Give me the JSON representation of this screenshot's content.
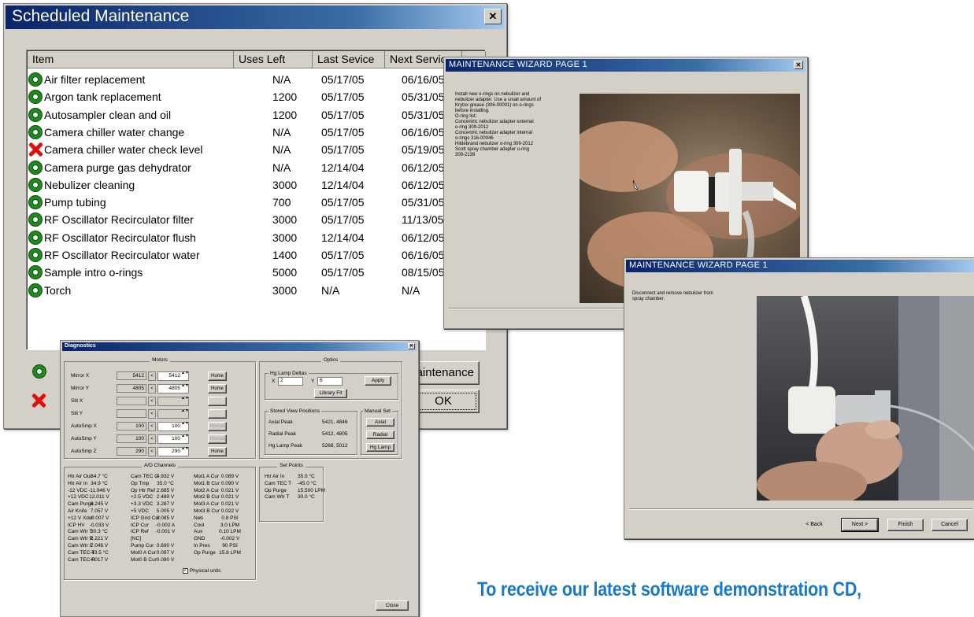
{
  "maint": {
    "title": "Scheduled Maintenance",
    "close": "✕",
    "headers": [
      "Item",
      "Uses Left",
      "Last Sevice",
      "Next Service"
    ],
    "rows": [
      {
        "status": "ok",
        "item": "Air filter replacement",
        "uses": "N/A",
        "last": "05/17/05",
        "next": "06/16/05"
      },
      {
        "status": "ok",
        "item": "Argon tank replacement",
        "uses": "1200",
        "last": "05/17/05",
        "next": "05/31/05"
      },
      {
        "status": "ok",
        "item": "Autosampler clean and oil",
        "uses": "1200",
        "last": "05/17/05",
        "next": "05/31/05"
      },
      {
        "status": "ok",
        "item": "Camera chiller water change",
        "uses": "N/A",
        "last": "05/17/05",
        "next": "06/16/05"
      },
      {
        "status": "error",
        "item": "Camera chiller water check level",
        "uses": "N/A",
        "last": "05/17/05",
        "next": "05/19/05"
      },
      {
        "status": "ok",
        "item": "Camera purge gas dehydrator",
        "uses": "N/A",
        "last": "12/14/04",
        "next": "06/12/05"
      },
      {
        "status": "ok",
        "item": "Nebulizer cleaning",
        "uses": "3000",
        "last": "12/14/04",
        "next": "06/12/05"
      },
      {
        "status": "ok",
        "item": "Pump tubing",
        "uses": "700",
        "last": "05/17/05",
        "next": "05/31/05"
      },
      {
        "status": "ok",
        "item": "RF Oscillator Recirculator filter",
        "uses": "3000",
        "last": "05/17/05",
        "next": "11/13/05"
      },
      {
        "status": "ok",
        "item": "RF Oscillator Recirculator flush",
        "uses": "3000",
        "last": "12/14/04",
        "next": "06/12/05"
      },
      {
        "status": "ok",
        "item": "RF Oscillator Recirculator water",
        "uses": "1400",
        "last": "05/17/05",
        "next": "06/16/05"
      },
      {
        "status": "ok",
        "item": "Sample intro o-rings",
        "uses": "5000",
        "last": "05/17/05",
        "next": "08/15/05"
      },
      {
        "status": "ok",
        "item": "Torch",
        "uses": "3000",
        "last": "N/A",
        "next": "N/A"
      }
    ],
    "maintenance_btn": "aintenance",
    "ok_btn": "OK"
  },
  "wizard1": {
    "title": "MAINTENANCE WIZARD PAGE 1",
    "close": "✕",
    "instructions": [
      "Install new o-rings on nebulizer and",
      "nebulizer adapter. Use a small amount of",
      "Krytox grease (306-00001) on o-rings",
      "before installing.",
      "O-ring list:",
      "Concentric nebulizer adapter external",
      "o-ring 309-2012",
      "Concentric nebulizer adapter internal",
      "o-rings 316-00046",
      "Hildebrand nebulizer o-ring 309-2012",
      "Scott spray chamber adapter o-ring",
      "309-2139"
    ]
  },
  "wizard2": {
    "title": "MAINTENANCE WIZARD PAGE 1",
    "instructions": [
      "Disconnect and remove nebulizer from",
      "spray chamber."
    ],
    "buttons": {
      "back": "< Back",
      "next": "Next >",
      "finish": "Finish",
      "cancel": "Cancel"
    }
  },
  "diag": {
    "title": "Diagnostics",
    "close": "✕",
    "motors": {
      "label": "Motors",
      "rows": [
        {
          "name": "Mirror X",
          "val": "5412",
          "set": "5412",
          "btn": "Home"
        },
        {
          "name": "Mirror Y",
          "val": "4805",
          "set": "4805",
          "btn": "Home"
        },
        {
          "name": "Slit X",
          "val": "",
          "set": "",
          "btn": ""
        },
        {
          "name": "Slit Y",
          "val": "",
          "set": "",
          "btn": ""
        },
        {
          "name": "AutoSmp X",
          "val": "100",
          "set": "100",
          "btn": "Homed"
        },
        {
          "name": "AutoSmp Y",
          "val": "100",
          "set": "100",
          "btn": "Homed"
        },
        {
          "name": "AutoSmp Z",
          "val": "290",
          "set": "290",
          "btn": "Home"
        }
      ]
    },
    "optics": {
      "label": "Optics",
      "lamp_label": "Hg Lamp Deltas",
      "x_label": "X",
      "x_val": "2",
      "y_label": "Y",
      "y_val": "6",
      "apply": "Apply",
      "library": "Library Fit",
      "stored_label": "Stored View Positions",
      "stored": [
        {
          "name": "Axial Peak",
          "val": "5421, 4846"
        },
        {
          "name": "Radial Peak",
          "val": "5412, 4805"
        },
        {
          "name": "Hg Lamp Peak",
          "val": "5268, 5012"
        }
      ],
      "manual_label": "Manual Set",
      "manual": [
        "Axial",
        "Radial",
        "Hg Lamp"
      ]
    },
    "ad": {
      "label": "A/D Channels",
      "col1": [
        [
          "Htr Air Out",
          "34.7 °C"
        ],
        [
          "Htr Air In",
          "34.9 °C"
        ],
        [
          "-12 VDC",
          "-11.946 V"
        ],
        [
          "+12 VDC",
          "12.011 V"
        ],
        [
          "Cam Purge",
          "3.245 V"
        ],
        [
          "Air Knife",
          "7.057 V"
        ],
        [
          "+12 V Xdcr",
          "-0.007 V"
        ],
        [
          "ICP HV",
          "-0.033 V"
        ],
        [
          "Cam Wtr T",
          "30.3 °C"
        ],
        [
          "Cam Wtr R",
          "2.221 V"
        ],
        [
          "Cam Wtr C",
          "7.046 V"
        ],
        [
          "Cam TEC T",
          "-43.5 °C"
        ],
        [
          "Cam TEC R",
          "4.017 V"
        ]
      ],
      "col2": [
        [
          "Cam TEC C",
          "4.932 V"
        ],
        [
          "Op Tmp",
          "35.0 °C"
        ],
        [
          "Op Htr Ref",
          "2.685 V"
        ],
        [
          "+2.5 VDC",
          "2.489 V"
        ],
        [
          "+3.3 VDC",
          "3.287 V"
        ],
        [
          "+5 VDC",
          "5.005 V"
        ],
        [
          "ICP Grid Cur",
          "0.085 V"
        ],
        [
          "ICP Cur",
          "-0.002 A"
        ],
        [
          "ICP Ref",
          "-0.001 V"
        ],
        [
          "[NC]",
          ""
        ],
        [
          "Pump Cur",
          "0.690 V"
        ],
        [
          "Mot0 A Cur",
          "0.097 V"
        ],
        [
          "Mot0 B Cur",
          "0.090 V"
        ]
      ],
      "col3": [
        [
          "Mot1 A Cur",
          "0.089 V"
        ],
        [
          "Mot1 B Cur",
          "0.090 V"
        ],
        [
          "Mot2 A Cur",
          "0.021 V"
        ],
        [
          "Mot2 B Cur",
          "0.021 V"
        ],
        [
          "Mot3 A Cur",
          "0.021 V"
        ],
        [
          "Mot3 B Cur",
          "0.022 V"
        ],
        [
          "Neb",
          "0.8 PSI"
        ],
        [
          "Cool",
          "3.0 LPM"
        ],
        [
          "Aux",
          "0.10 LPM"
        ],
        [
          "GND",
          "-0.002 V"
        ],
        [
          "In Pres",
          "90 PSI"
        ],
        [
          "Op Purge",
          "15.8 LPM"
        ]
      ],
      "physical_units": "Physical units"
    },
    "setpoints": {
      "label": "Set Points",
      "rows": [
        [
          "Htr Air In",
          "35.0 °C"
        ],
        [
          "Cam TEC T",
          "-45.0 °C"
        ],
        [
          "Op Purge",
          "15.500 LPM"
        ],
        [
          "Cam Wtr T",
          "30.0 °C"
        ]
      ]
    },
    "close_btn": "Close"
  },
  "promo": "To receive our latest software demonstration CD,",
  "colors": {
    "ok": "#1f8a1f",
    "error": "#e01010",
    "promo": "#1a78c8",
    "titlebar": "#0a246a"
  }
}
